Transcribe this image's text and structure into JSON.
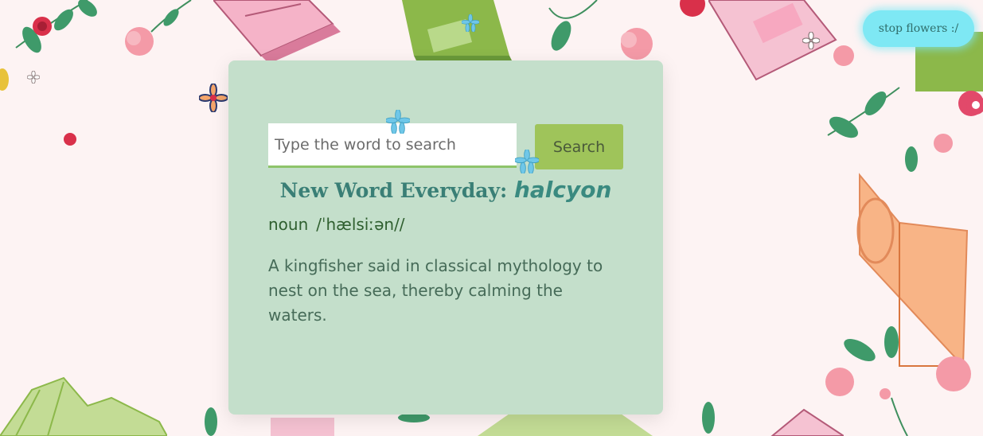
{
  "toggle": {
    "label": "stop flowers :/"
  },
  "search": {
    "placeholder": "Type the word to search",
    "value": "",
    "button_label": "Search"
  },
  "word_of_day": {
    "heading_prefix": "New Word Everyday:",
    "word": "halcyon",
    "part_of_speech": "noun",
    "phonetic": "/ˈhælsiːən//",
    "definition": "A kingfisher said in classical mythology to nest on the sea, thereby calming the waters."
  },
  "colors": {
    "background": "#fdf3f3",
    "card": "#c4dfcb",
    "accent_button": "#9fc45a",
    "toggle_button": "#7ee8f4",
    "heading": "#3a7f76"
  },
  "decorations": [
    "book-illustration",
    "leaf-branch",
    "pink-tulip",
    "falling-flower"
  ]
}
